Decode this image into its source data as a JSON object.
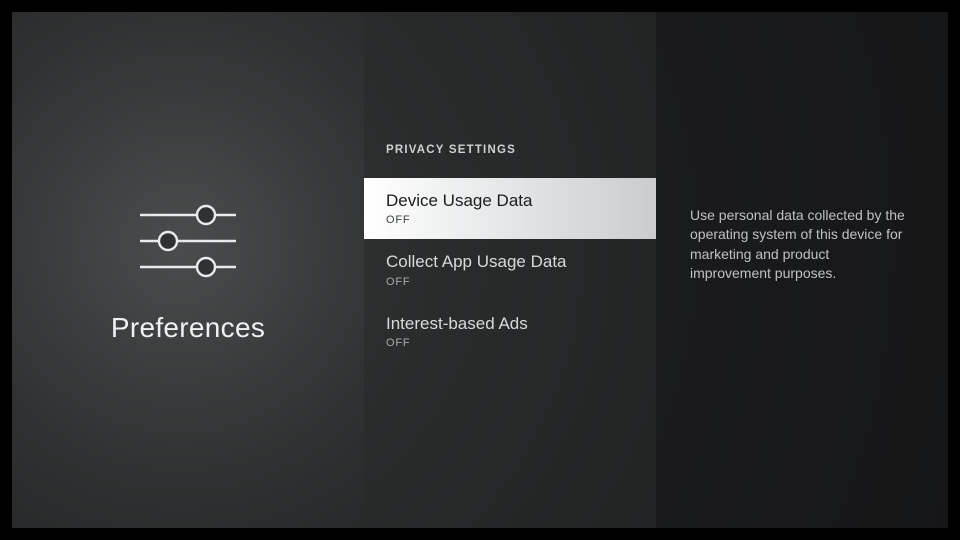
{
  "left": {
    "title": "Preferences"
  },
  "section": {
    "heading": "PRIVACY SETTINGS",
    "items": [
      {
        "title": "Device Usage Data",
        "status": "OFF"
      },
      {
        "title": "Collect App Usage Data",
        "status": "OFF"
      },
      {
        "title": "Interest-based Ads",
        "status": "OFF"
      }
    ]
  },
  "description": "Use personal data collected by the operating system of this device for marketing and product improvement purposes."
}
